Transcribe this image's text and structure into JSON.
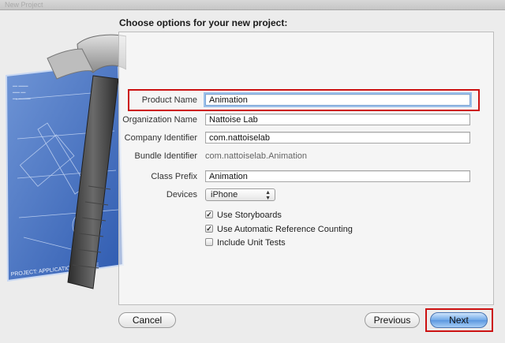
{
  "window": {
    "title": "New Project"
  },
  "heading": "Choose options for your new project:",
  "form": {
    "product_name": {
      "label": "Product Name",
      "value": "Animation"
    },
    "organization_name": {
      "label": "Organization Name",
      "value": "Nattoise Lab"
    },
    "company_identifier": {
      "label": "Company Identifier",
      "value": "com.nattoiselab"
    },
    "bundle_identifier": {
      "label": "Bundle Identifier",
      "value": "com.nattoiselab.Animation"
    },
    "class_prefix": {
      "label": "Class Prefix",
      "value": "Animation"
    },
    "devices": {
      "label": "Devices",
      "value": "iPhone"
    },
    "options": [
      {
        "label": "Use Storyboards",
        "checked": true
      },
      {
        "label": "Use Automatic Reference Counting",
        "checked": true
      },
      {
        "label": "Include Unit Tests",
        "checked": false
      }
    ]
  },
  "buttons": {
    "cancel": "Cancel",
    "previous": "Previous",
    "next": "Next"
  },
  "highlight_color": "#cc1111",
  "blueprint_caption": "PROJECT: APPLICATION - XCODE"
}
